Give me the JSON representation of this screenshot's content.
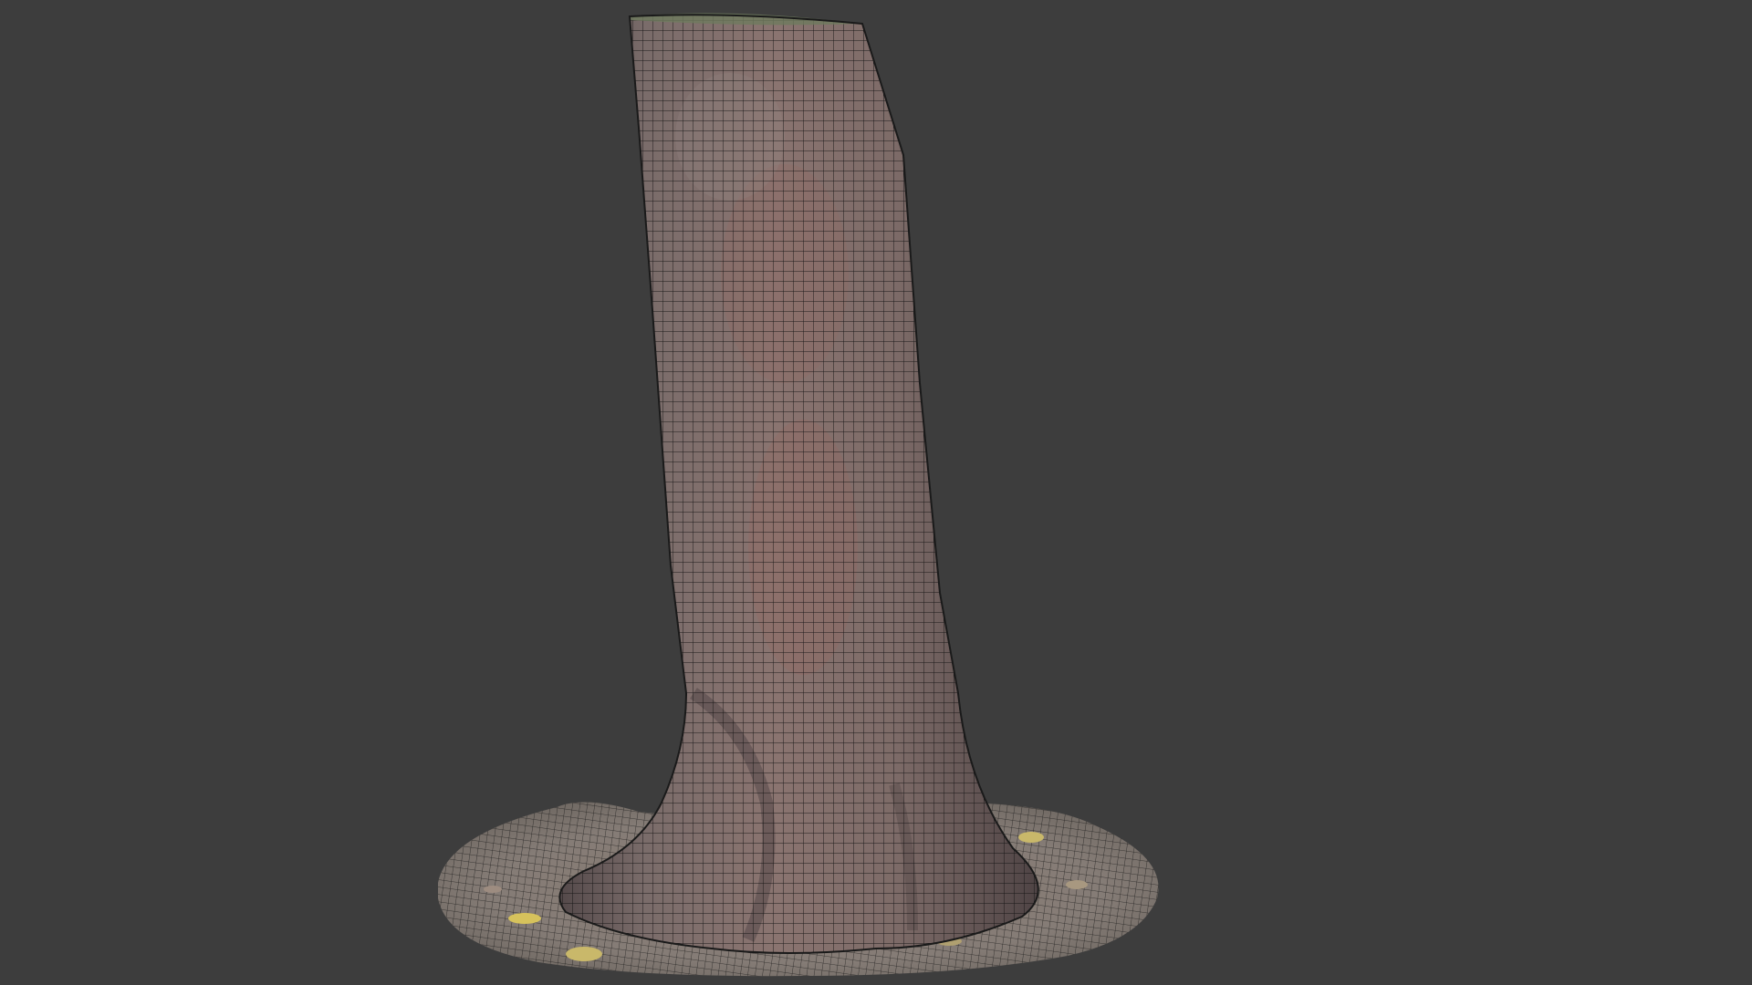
{
  "viewport": {
    "background_color": "#3d3d3d",
    "object": "tree-trunk-mesh",
    "display_mode": "textured-wireframe"
  },
  "colors": {
    "bark": "#7b6e6b",
    "bark_dark": "#5e5250",
    "bark_reddish": "#8d6c66",
    "ground": "#857a73",
    "leaf_yellow": "#c9b86a",
    "wire": "#111111"
  }
}
